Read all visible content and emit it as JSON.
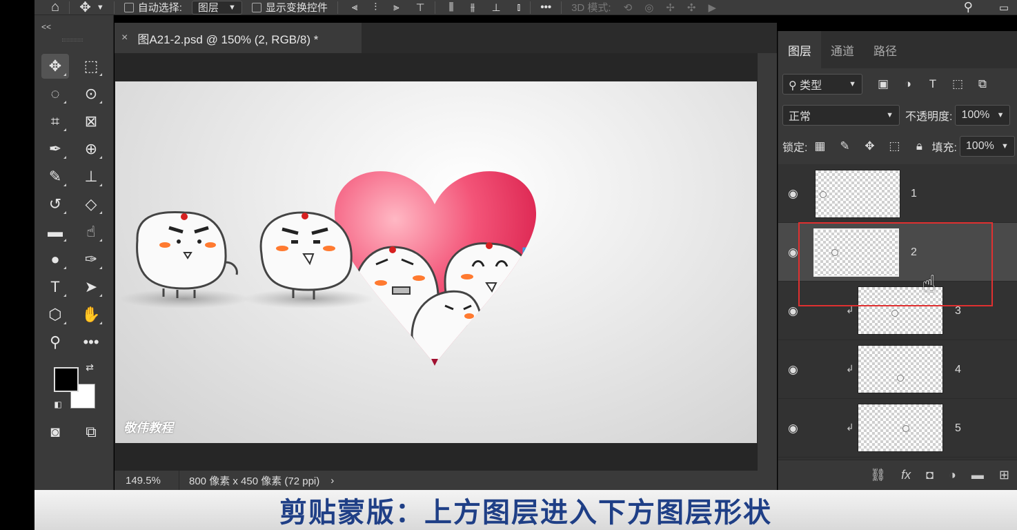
{
  "options_bar": {
    "auto_select_label": "自动选择:",
    "auto_select_value": "图层",
    "show_transform_label": "显示变换控件",
    "mode_3d_label": "3D 模式:"
  },
  "toolbox": {
    "collapse": "<<"
  },
  "document": {
    "tab_close": "×",
    "tab_title": "图A21-2.psd @ 150% (2, RGB/8) *",
    "watermark": "敬伟教程"
  },
  "status": {
    "zoom": "149.5%",
    "info": "800 像素 x 450 像素 (72 ppi)",
    "arrow": "›"
  },
  "panel": {
    "tabs": [
      "图层",
      "通道",
      "路径"
    ],
    "filter_label": "类型",
    "blend_mode": "正常",
    "opacity_label": "不透明度:",
    "opacity_value": "100%",
    "lock_label": "锁定:",
    "fill_label": "填充:",
    "fill_value": "100%",
    "layers": [
      {
        "name": "1",
        "clipped": false,
        "selected": false
      },
      {
        "name": "2",
        "clipped": false,
        "selected": true
      },
      {
        "name": "3",
        "clipped": true,
        "selected": false
      },
      {
        "name": "4",
        "clipped": true,
        "selected": false
      },
      {
        "name": "5",
        "clipped": true,
        "selected": false
      }
    ]
  },
  "subtitle": "剪贴蒙版：上方图层进入下方图层形状",
  "colors": {
    "accent_red": "#e03030",
    "subtitle_blue": "#1f3f86",
    "heart_pink": "#f04a6a"
  }
}
